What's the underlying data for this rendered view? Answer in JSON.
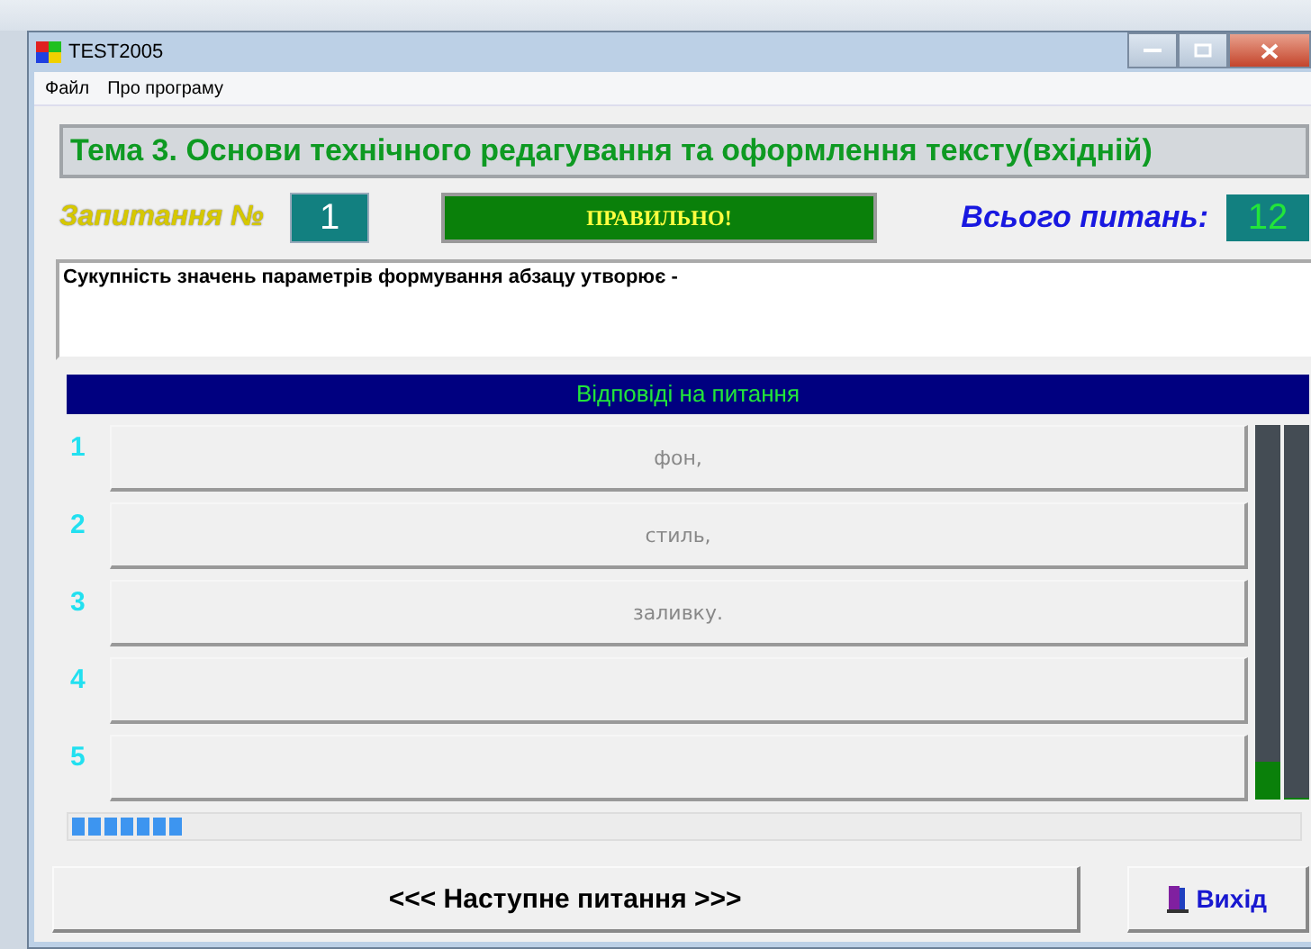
{
  "window": {
    "title": "TEST2005"
  },
  "menu": [
    "Файл",
    "Про програму"
  ],
  "topic": "Тема 3. Основи технічного редагування та оформлення тексту(вхідній)",
  "question_label": "Запитання №",
  "question_number": "1",
  "result": "ПРАВИЛЬНО!",
  "total_label": "Всього питань:",
  "total_count": "12",
  "question_text": "Сукупність значень параметрів формування абзацу утворює -",
  "answers_header": "Відповіді на питання",
  "answers": [
    {
      "number": "1",
      "text": "фон,"
    },
    {
      "number": "2",
      "text": "стиль,"
    },
    {
      "number": "3",
      "text": "заливку."
    },
    {
      "number": "4"
    },
    {
      "number": "5"
    }
  ],
  "meters": [
    {
      "level": 0.1
    },
    {
      "level": 0
    }
  ],
  "progress": {
    "level": 0.09
  },
  "buttons": {
    "next": "<<< Наступне питання >>>",
    "exit": "Вихід"
  }
}
